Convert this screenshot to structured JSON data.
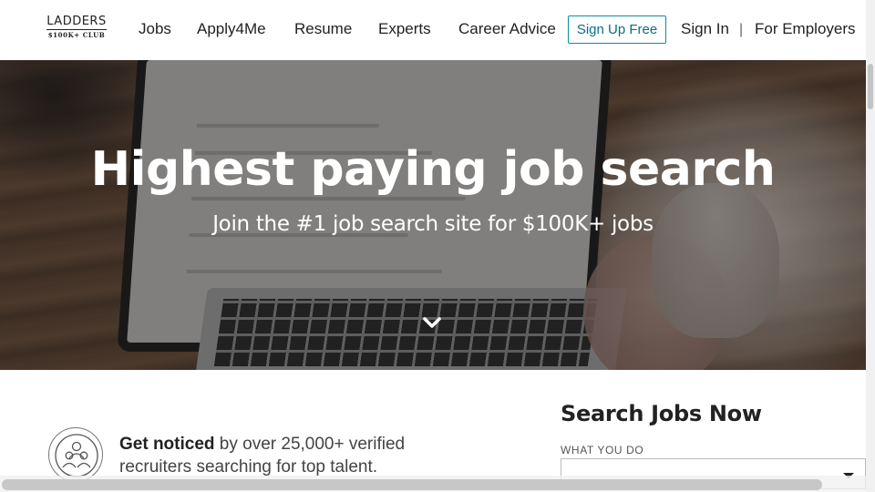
{
  "logo": {
    "main": "LADDERS",
    "sub": "$100K+ CLUB"
  },
  "nav": {
    "jobs": "Jobs",
    "apply4me": "Apply4Me",
    "resume": "Resume",
    "experts": "Experts",
    "career_advice": "Career Advice",
    "sign_up": "Sign Up Free",
    "sign_in": "Sign In",
    "divider": "|",
    "for_employers": "For Employers"
  },
  "hero": {
    "title": "Highest paying job search",
    "subtitle": "Join the #1 job search site for $100K+ jobs",
    "scroll_icon": "chevron-down-icon"
  },
  "features": {
    "badge_icon": "people-group-icon",
    "noticed_bold": "Get noticed",
    "noticed_rest": " by over 25,000+ verified recruiters searching for top talent."
  },
  "search": {
    "title": "Search Jobs Now",
    "what_label": "WHAT YOU DO",
    "what_value": ""
  },
  "colors": {
    "accent": "#0a8fa8",
    "text": "#222222"
  }
}
